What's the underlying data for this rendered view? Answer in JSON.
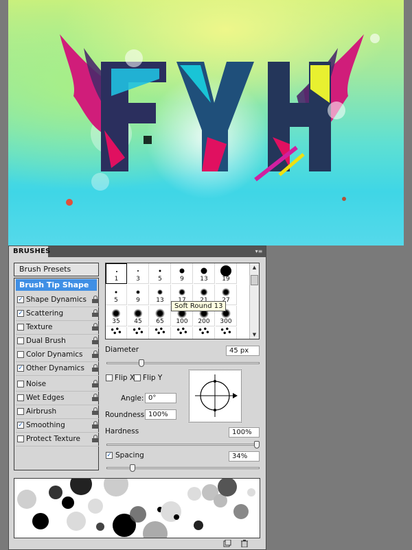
{
  "panel": {
    "tab_label": "BRUSHES",
    "menu_icon": "panel-menu-icon",
    "presets_button": "Brush Presets",
    "selected_option": "Brush Tip Shape",
    "options": [
      {
        "label": "Shape Dynamics",
        "checked": true,
        "locked": true
      },
      {
        "label": "Scattering",
        "checked": true,
        "locked": true
      },
      {
        "label": "Texture",
        "checked": false,
        "locked": true
      },
      {
        "label": "Dual Brush",
        "checked": false,
        "locked": true
      },
      {
        "label": "Color Dynamics",
        "checked": false,
        "locked": true
      },
      {
        "label": "Other Dynamics",
        "checked": true,
        "locked": true
      },
      {
        "label": "Noise",
        "checked": false,
        "locked": true
      },
      {
        "label": "Wet Edges",
        "checked": false,
        "locked": true
      },
      {
        "label": "Airbrush",
        "checked": false,
        "locked": true
      },
      {
        "label": "Smoothing",
        "checked": true,
        "locked": true
      },
      {
        "label": "Protect Texture",
        "checked": false,
        "locked": true
      }
    ],
    "checkmark": "✓"
  },
  "brush_grid": {
    "rows": [
      [
        "1",
        "3",
        "5",
        "9",
        "13",
        "19"
      ],
      [
        "5",
        "9",
        "13",
        "17",
        "21",
        "27"
      ],
      [
        "35",
        "45",
        "65",
        "100",
        "200",
        "300"
      ]
    ],
    "selected": "1",
    "tooltip": "Soft Round 13"
  },
  "settings": {
    "diameter_label": "Diameter",
    "diameter_value": "45 px",
    "diameter_fraction": 0.22,
    "flip_x_label": "Flip X",
    "flip_y_label": "Flip Y",
    "angle_label": "Angle:",
    "angle_value": "0°",
    "roundness_label": "Roundness:",
    "roundness_value": "100%",
    "hardness_label": "Hardness",
    "hardness_value": "100%",
    "hardness_fraction": 1.0,
    "spacing_label": "Spacing",
    "spacing_value": "34%",
    "spacing_checked": true,
    "spacing_fraction": 0.16
  },
  "artwork": {
    "text": "FYH"
  },
  "footer": {
    "new_icon": "new-brush-icon",
    "delete_icon": "trash-icon"
  }
}
